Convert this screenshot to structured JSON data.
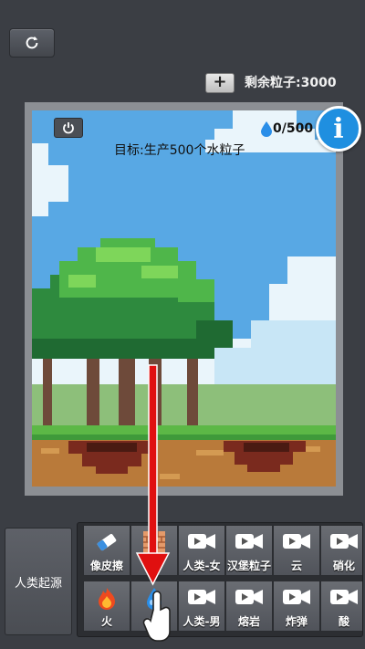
{
  "header": {
    "remaining_label": "剩余粒子:3000",
    "reset_icon": "refresh-icon",
    "plus_label": "+"
  },
  "game": {
    "goal": "目标:生产500个水粒子",
    "counter": "0/500",
    "counter_icon": "water-drop-icon",
    "power_icon": "power-icon",
    "info_label": "i"
  },
  "toolbar": {
    "category_label": "人类起源",
    "row1": [
      {
        "label": "像皮擦",
        "icon": "eraser-icon",
        "locked": false
      },
      {
        "label": "墙",
        "icon": "brick-wall-icon",
        "locked": false
      },
      {
        "label": "人类-女",
        "icon": "video-ad-icon",
        "locked": true
      },
      {
        "label": "汉堡粒子",
        "icon": "video-ad-icon",
        "locked": true
      },
      {
        "label": "云",
        "icon": "video-ad-icon",
        "locked": true
      },
      {
        "label": "硝化",
        "icon": "video-ad-icon",
        "locked": true
      }
    ],
    "row2": [
      {
        "label": "火",
        "icon": "fire-icon",
        "locked": false
      },
      {
        "label": "水",
        "icon": "water-drop-icon",
        "locked": false
      },
      {
        "label": "人类-男",
        "icon": "video-ad-icon",
        "locked": true
      },
      {
        "label": "熔岩",
        "icon": "video-ad-icon",
        "locked": true
      },
      {
        "label": "炸弹",
        "icon": "video-ad-icon",
        "locked": true
      },
      {
        "label": "酸",
        "icon": "video-ad-icon",
        "locked": true
      }
    ]
  },
  "tutorial": {
    "arrow_color": "#e01010",
    "hand_icon": "pointer-hand-icon"
  }
}
